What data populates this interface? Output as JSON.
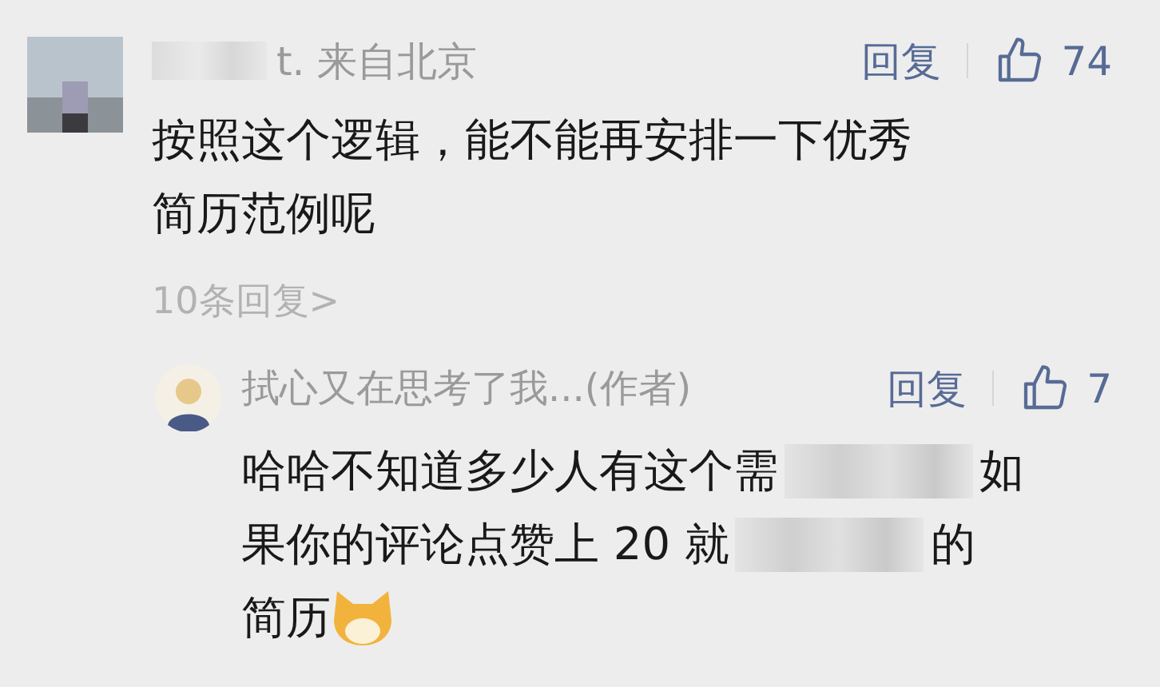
{
  "comment": {
    "name_suffix": "t. 来自北京",
    "reply_label": "回复",
    "likes": "74",
    "body_lines": [
      "按照这个逻辑，能不能再安排一下优秀",
      "简历范例呢"
    ],
    "replies_link": "10条回复",
    "replies_chevron": ">"
  },
  "reply": {
    "name": "拭心又在思考了我...(作者)",
    "reply_label": "回复",
    "likes": "7",
    "lines": [
      [
        {
          "kind": "text",
          "text": "哈哈不知道多少人有这个需"
        },
        {
          "kind": "redacted"
        },
        {
          "kind": "text",
          "text": "如"
        }
      ],
      [
        {
          "kind": "text",
          "text": "果你的评论点赞上 20 就"
        },
        {
          "kind": "redacted"
        },
        {
          "kind": "text",
          "text": "的"
        }
      ],
      [
        {
          "kind": "text",
          "text": "简历"
        },
        {
          "kind": "emoji"
        }
      ]
    ]
  }
}
